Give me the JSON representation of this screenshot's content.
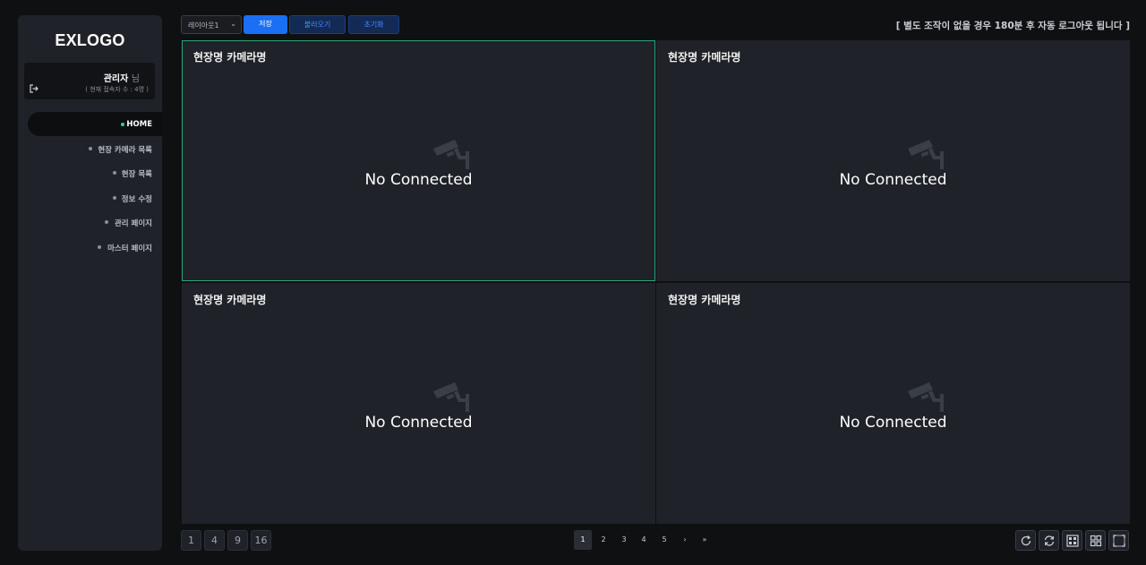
{
  "sidebar": {
    "logo": "EXLOGO",
    "user": {
      "name": "관리자",
      "suffix": "님",
      "connected": "( 현재 접속자 수 : 4명 )"
    },
    "items": [
      {
        "label": "HOME",
        "active": true
      },
      {
        "label": "현장 카메라 목록"
      },
      {
        "label": "현장 목록"
      },
      {
        "label": "정보 수정"
      },
      {
        "label": "관리 페이지"
      },
      {
        "label": "마스터 페이지"
      }
    ]
  },
  "toolbar": {
    "layout_select": "레이아웃1",
    "save_label": "저장",
    "load_label": "불러오기",
    "reset_label": "초기화",
    "notice": "[ 별도 조작이 없을 경우 180분 후 자동 로그아웃 됩니다 ]"
  },
  "cameras": [
    {
      "title": "현장명 카메라명",
      "status": "No Connected"
    },
    {
      "title": "현장명 카메라명",
      "status": "No Connected"
    },
    {
      "title": "현장명 카메라명",
      "status": "No Connected"
    },
    {
      "title": "현장명 카메라명",
      "status": "No Connected"
    }
  ],
  "layout_buttons": [
    "1",
    "4",
    "9",
    "16"
  ],
  "pagination": {
    "pages": [
      "1",
      "2",
      "3",
      "4",
      "5"
    ],
    "current": "1",
    "next": "›",
    "last": "»"
  },
  "actions": [
    "refresh-icon",
    "auto-refresh-icon",
    "layout-grid-9-icon",
    "layout-grid-4-icon",
    "fullscreen-icon"
  ],
  "colors": {
    "accent": "#1a6ff5",
    "active_border": "#28a67a",
    "active_dot": "#2bd39d"
  }
}
